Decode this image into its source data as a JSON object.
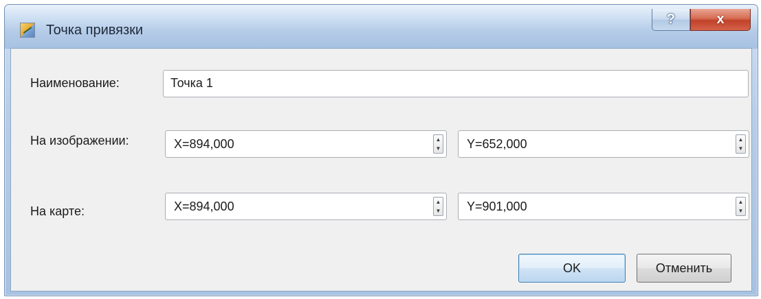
{
  "window": {
    "title": "Точка привязки",
    "help_label": "?",
    "close_label": "x"
  },
  "form": {
    "name_label": "Наименование:",
    "name_value": "Точка 1",
    "image_label": "На изображении:",
    "image_x": "X=894,000",
    "image_y": "Y=652,000",
    "map_label": "На карте:",
    "map_x": "X=894,000",
    "map_y": "Y=901,000"
  },
  "spin_glyphs": {
    "up": "▲",
    "down": "▼"
  },
  "buttons": {
    "ok_label": "OK",
    "cancel_label": "Отменить"
  },
  "icons": [
    "app-icon",
    "help-icon",
    "close-icon",
    "spin-up-icon",
    "spin-down-icon"
  ],
  "colors": {
    "titlebar": "#b5cce8",
    "close_button": "#c2412a",
    "client_bg": "#f0f0f0",
    "default_button_border": "#3c7fb1"
  }
}
